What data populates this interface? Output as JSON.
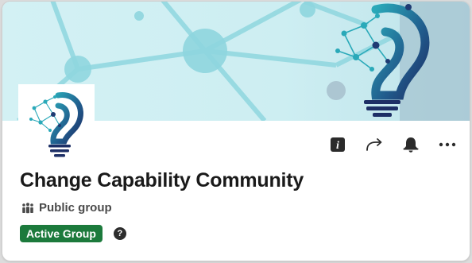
{
  "group": {
    "name": "Change Capability Community",
    "privacy_label": "Public group",
    "status_badge": "Active Group",
    "help_symbol": "?"
  },
  "actions": [
    {
      "name": "info",
      "icon": "info-icon"
    },
    {
      "name": "share",
      "icon": "share-arrow-icon"
    },
    {
      "name": "notifications",
      "icon": "bell-icon"
    },
    {
      "name": "more",
      "icon": "more-dots-icon"
    }
  ],
  "colors": {
    "cover_bg": "#cfeef2",
    "network_teal": "#7ccfd9",
    "bulb_navy": "#1f3b73",
    "bulb_teal": "#29a8b8",
    "badge_green": "#1c7a3c",
    "title_text": "#1a1a1a"
  }
}
